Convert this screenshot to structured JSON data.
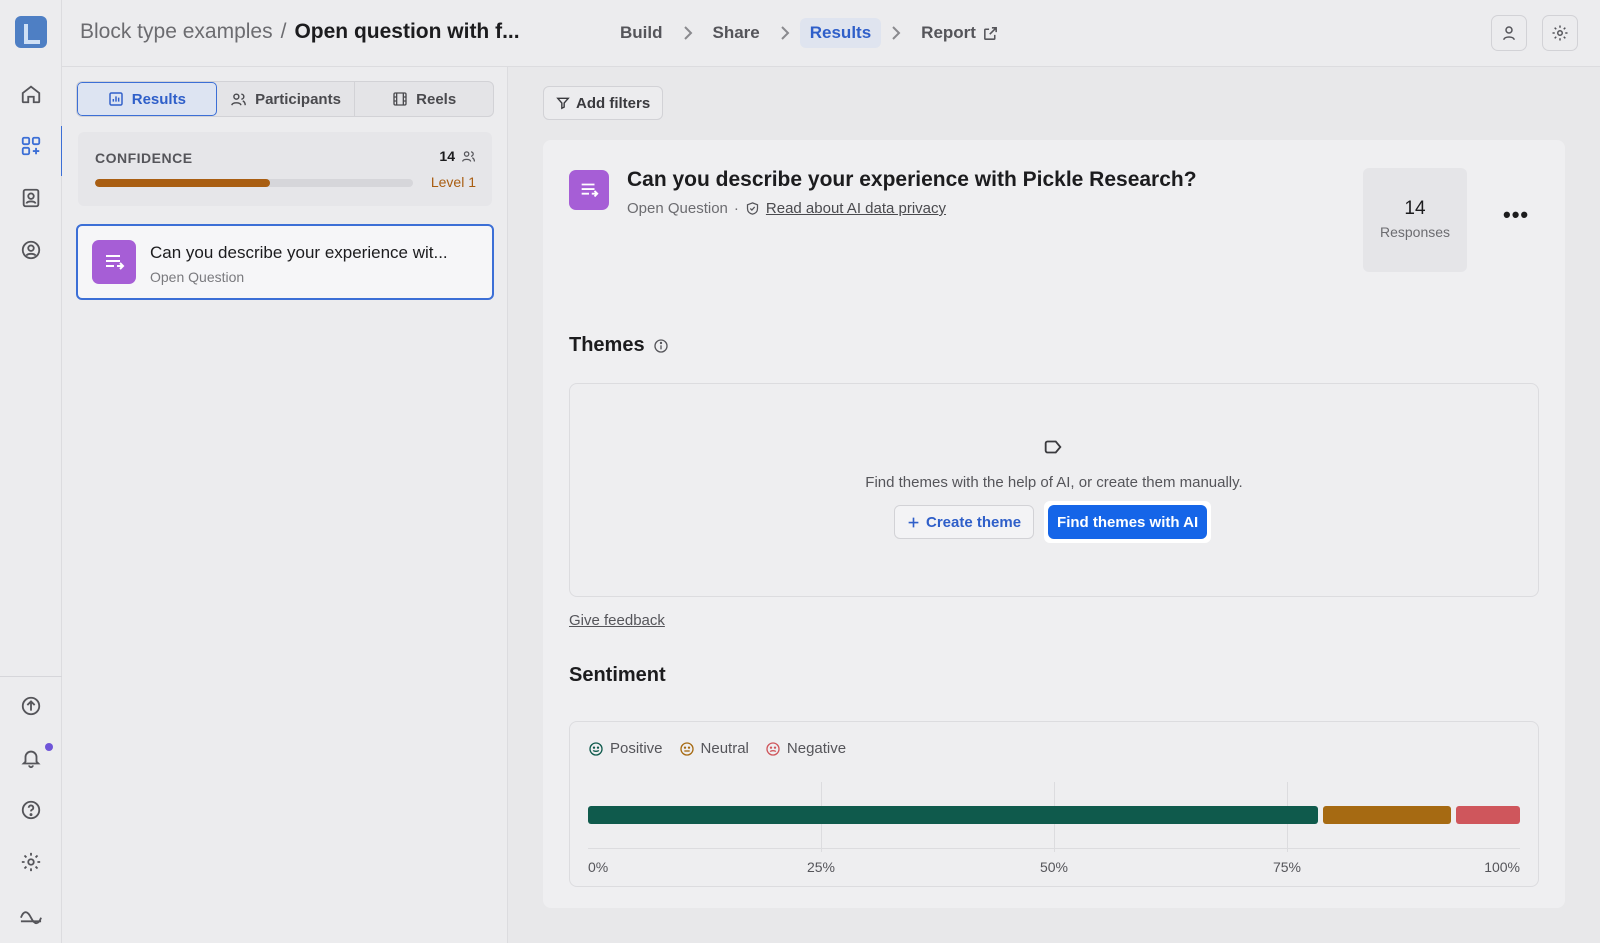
{
  "breadcrumb": {
    "project": "Block type examples",
    "separator": "/",
    "current": "Open question with f..."
  },
  "steps": [
    {
      "label": "Build"
    },
    {
      "label": "Share"
    },
    {
      "label": "Results"
    },
    {
      "label": "Report"
    }
  ],
  "left_tabs": [
    {
      "label": "Results"
    },
    {
      "label": "Participants"
    },
    {
      "label": "Reels"
    }
  ],
  "confidence": {
    "label": "CONFIDENCE",
    "count": "14",
    "level": "Level 1",
    "progress_percent": 55
  },
  "question_card": {
    "title": "Can you describe your experience wit...",
    "type": "Open Question"
  },
  "filters": {
    "label": "Add filters"
  },
  "question": {
    "title": "Can you describe your experience with Pickle Research?",
    "type": "Open Question",
    "dot": "·",
    "privacy_link": "Read about AI data privacy",
    "responses_count": "14",
    "responses_label": "Responses",
    "more": "•••"
  },
  "themes": {
    "title": "Themes",
    "hint": "Find themes with the help of AI, or create them manually.",
    "create_button": "Create theme",
    "ai_button": "Find themes with AI"
  },
  "feedback": {
    "label": "Give feedback"
  },
  "sentiment": {
    "title": "Sentiment",
    "legend": [
      {
        "label": "Positive",
        "color": "#0f5a4c"
      },
      {
        "label": "Neutral",
        "color": "#a66a12"
      },
      {
        "label": "Negative",
        "color": "#cf565c"
      }
    ],
    "ticks": [
      "0%",
      "25%",
      "50%",
      "75%",
      "100%"
    ],
    "values": [
      {
        "name": "Positive",
        "percent": 78.6
      },
      {
        "name": "Neutral",
        "percent": 14.3
      },
      {
        "name": "Negative",
        "percent": 7.1
      }
    ]
  },
  "colors": {
    "accent": "#2f5fc9",
    "primary_button": "#1565e8",
    "question_icon": "#a65ed6",
    "confidence": "#a95e12"
  }
}
